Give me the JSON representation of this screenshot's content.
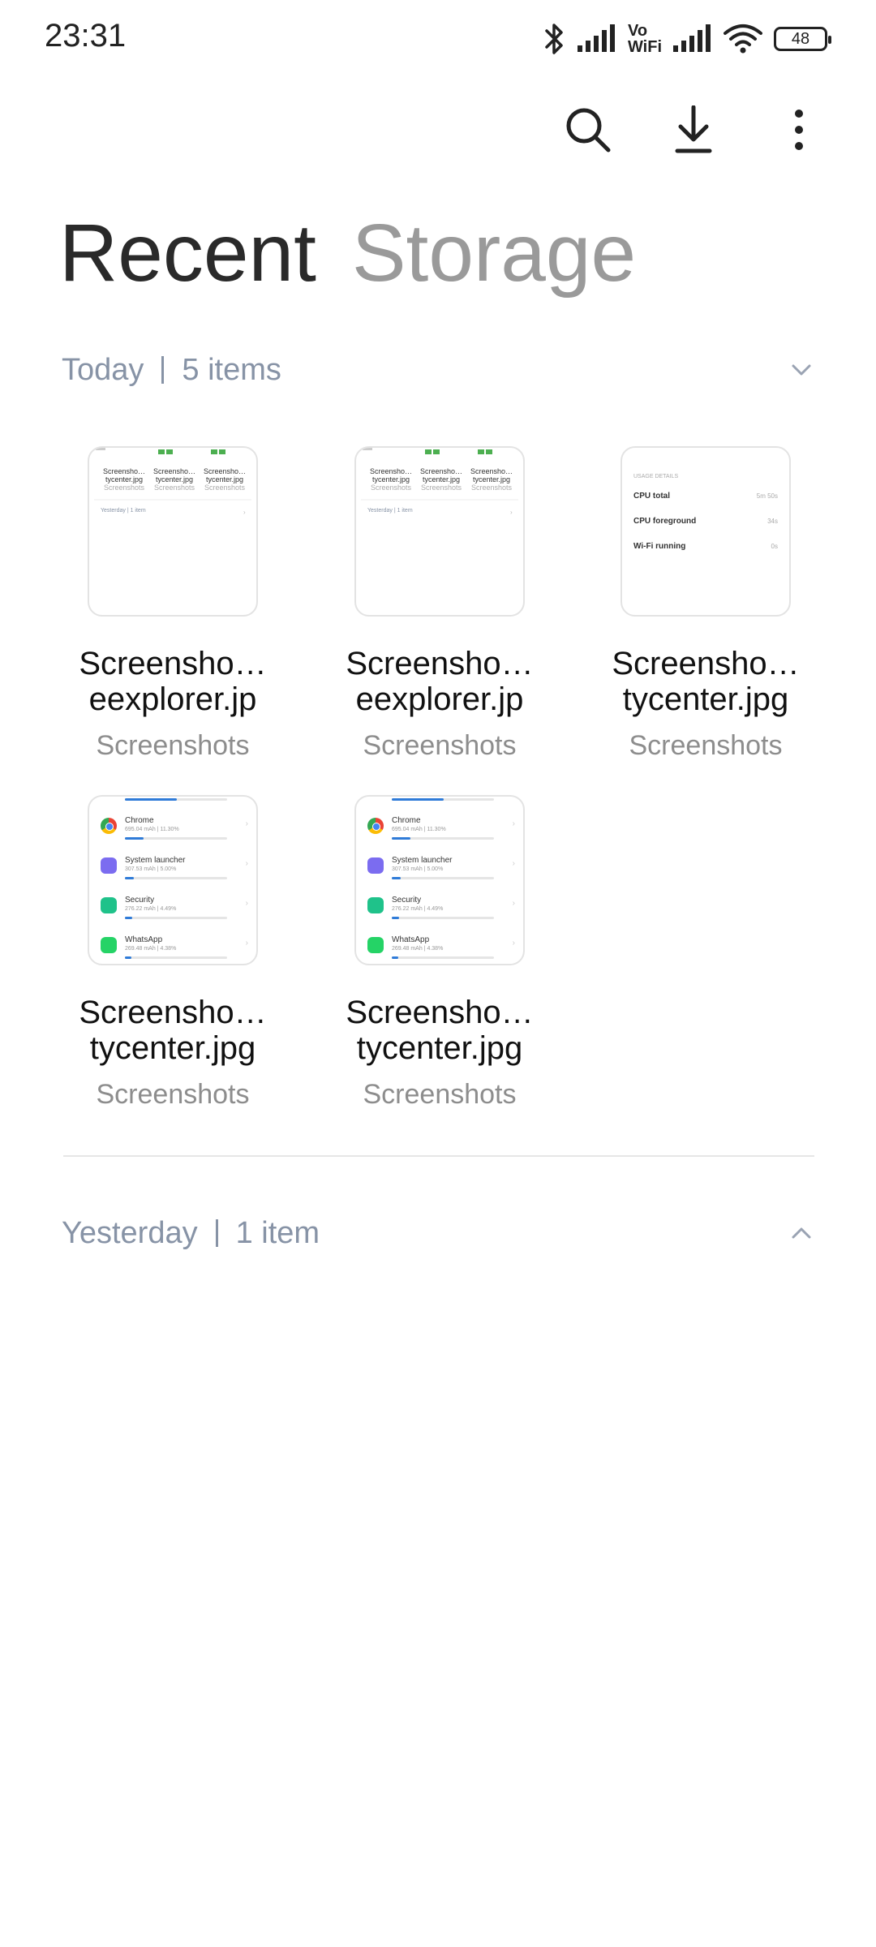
{
  "status_bar": {
    "time": "23:31",
    "vowifi_top": "Vo",
    "vowifi_bottom": "WiFi",
    "battery": "48",
    "icons": [
      "bluetooth-icon",
      "signal-icon",
      "wifi-icon",
      "battery-icon"
    ]
  },
  "toolbar": {
    "icons": [
      "search-icon",
      "download-icon",
      "more-vertical-icon"
    ]
  },
  "tabs": [
    {
      "label": "Recent",
      "active": true
    },
    {
      "label": "Storage",
      "active": false
    }
  ],
  "sections": {
    "today": {
      "title": "Today",
      "count": "5 items"
    },
    "yesterday": {
      "title": "Yesterday",
      "count": "1 item"
    }
  },
  "files": [
    {
      "line1": "Screensho…",
      "line2": "eexplorer.jp",
      "folder": "Screenshots"
    },
    {
      "line1": "Screensho…",
      "line2": "eexplorer.jp",
      "folder": "Screenshots"
    },
    {
      "line1": "Screensho…",
      "line2": "tycenter.jpg",
      "folder": "Screenshots"
    },
    {
      "line1": "Screensho…",
      "line2": "tycenter.jpg",
      "folder": "Screenshots"
    },
    {
      "line1": "Screensho…",
      "line2": "tycenter.jpg",
      "folder": "Screenshots"
    }
  ],
  "thumb_explorer": {
    "cells": [
      {
        "name": "Screensho…",
        "file": "tycenter.jpg",
        "folder": "Screenshots"
      },
      {
        "name": "Screensho…",
        "file": "tycenter.jpg",
        "folder": "Screenshots"
      },
      {
        "name": "Screensho…",
        "file": "tycenter.jpg",
        "folder": "Screenshots"
      }
    ],
    "section": "Yesterday | 1 item"
  },
  "thumb_usage": {
    "header": "USAGE DETAILS",
    "rows": [
      {
        "label": "CPU total",
        "value": "5m 50s"
      },
      {
        "label": "CPU foreground",
        "value": "34s"
      },
      {
        "label": "Wi-Fi running",
        "value": "0s"
      }
    ]
  },
  "thumb_battery": {
    "apps": [
      {
        "name": "Chrome",
        "detail": "695.04 mAh | 11.30%",
        "color": "#ffffff",
        "bar": 0.18
      },
      {
        "name": "System launcher",
        "detail": "307.53 mAh | 5.00%",
        "color": "#7b6cf0",
        "bar": 0.09
      },
      {
        "name": "Security",
        "detail": "276.22 mAh | 4.49%",
        "color": "#1fc28a",
        "bar": 0.07
      },
      {
        "name": "WhatsApp",
        "detail": "269.48 mAh | 4.38%",
        "color": "#25d366",
        "bar": 0.06
      }
    ]
  },
  "colors": {
    "accent": "#2f7bd8",
    "section_text": "#8793a6",
    "inactive_tab": "#9a9a9a"
  }
}
